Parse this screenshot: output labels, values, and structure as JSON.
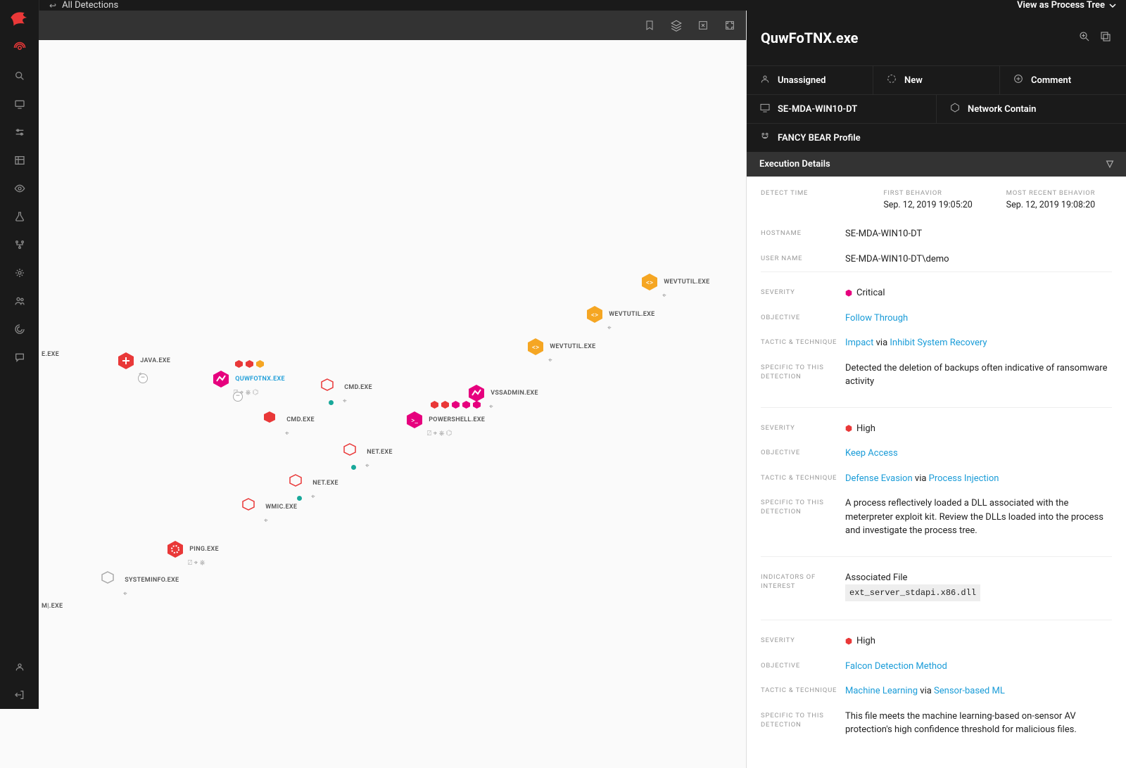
{
  "topbar": {
    "back_glyph": "↩",
    "crumb": "All Detections",
    "view_as": "View as Process Tree"
  },
  "panel": {
    "title": "QuwFoTNX.exe",
    "tags1": {
      "assigned": "Unassigned",
      "status": "New",
      "comment": "Comment"
    },
    "tags2": {
      "host": "SE-MDA-WIN10-DT",
      "contain": "Network Contain"
    },
    "profile": "FANCY BEAR Profile",
    "section": "Execution Details"
  },
  "detailtop": {
    "detect_time_hdr": "DETECT TIME",
    "detect_time": "",
    "first_beh_hdr": "FIRST BEHAVIOR",
    "first_beh": "Sep. 12, 2019 19:05:20",
    "recent_beh_hdr": "MOST RECENT BEHAVIOR",
    "recent_beh": "Sep. 12, 2019 19:08:20"
  },
  "kvs": {
    "hostname_k": "HOSTNAME",
    "hostname_v": "SE-MDA-WIN10-DT",
    "username_k": "USER NAME",
    "username_v": "SE-MDA-WIN10-DT\\demo"
  },
  "detections": [
    {
      "severity_label": "Critical",
      "severity_class": "sev-crit",
      "objective": "Follow Through",
      "tactic": "Impact",
      "tactic_via": "via",
      "technique": "Inhibit System Recovery",
      "specific": "Detected the deletion of backups often indicative of ransomware activity"
    },
    {
      "severity_label": "High",
      "severity_class": "sev-high",
      "objective": "Keep Access",
      "tactic": "Defense Evasion",
      "tactic_via": "via",
      "technique": "Process Injection",
      "specific": "A process reflectively loaded a DLL associated with the meterpreter exploit kit. Review the DLLs loaded into the process and investigate the process tree."
    },
    {
      "severity_label": "High",
      "severity_class": "sev-high",
      "objective": "Falcon Detection Method",
      "tactic": "Machine Learning",
      "tactic_via": "via",
      "technique": "Sensor-based ML",
      "specific": "This file meets the machine learning-based on-sensor AV protection's high confidence threshold for malicious files."
    }
  ],
  "ioi": {
    "hdr": "INDICATORS OF INTEREST",
    "label": "Associated File",
    "file": "ext_server_stdapi.x86.dll"
  },
  "labels": {
    "severity": "SEVERITY",
    "objective": "OBJECTIVE",
    "tactic": "TACTIC & TECHNIQUE",
    "specific": "SPECIFIC TO THIS DETECTION"
  },
  "nodes": {
    "root": "E.EXE",
    "java": "JAVA.EXE",
    "quw": "QUWFOTNX.EXE",
    "cmd1": "CMD.EXE",
    "cmd2": "CMD.EXE",
    "net1": "NET.EXE",
    "net2": "NET.EXE",
    "wmic": "WMIC.EXE",
    "ping": "PING.EXE",
    "sysinfo": "SYSTEMINFO.EXE",
    "ml": "M|.EXE",
    "vss": "VSSADMIN.EXE",
    "ps": "POWERSHELL.EXE",
    "wev1": "WEVTUTIL.EXE",
    "wev2": "WEVTUTIL.EXE",
    "wev3": "WEVTUTIL.EXE"
  },
  "icons": {
    "meta": "⌖"
  }
}
